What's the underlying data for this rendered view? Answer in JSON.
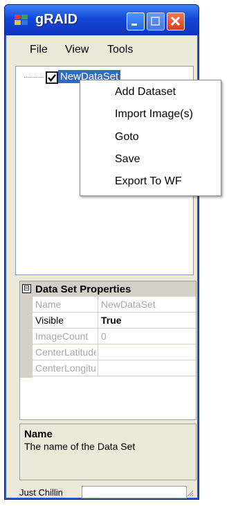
{
  "window": {
    "title": "gRAID"
  },
  "menubar": {
    "items": [
      "File",
      "View",
      "Tools"
    ]
  },
  "tree": {
    "node_label": "NewDataSet",
    "node_checked": true
  },
  "context_menu": {
    "items": [
      "Add Dataset",
      "Import Image(s)",
      "Goto",
      "Save",
      "Export To WF"
    ]
  },
  "property_grid": {
    "category": "Data Set Properties",
    "category_toggle": "⊟",
    "rows": [
      {
        "name": "Name",
        "value": "NewDataSet"
      },
      {
        "name": "Visible",
        "value": "True"
      },
      {
        "name": "ImageCount",
        "value": "0"
      },
      {
        "name": "CenterLatitude",
        "value": ""
      },
      {
        "name": "CenterLongitude",
        "value": ""
      }
    ]
  },
  "description": {
    "title": "Name",
    "text": "The name of the Data Set"
  },
  "statusbar": {
    "text": "Just Chillin"
  }
}
